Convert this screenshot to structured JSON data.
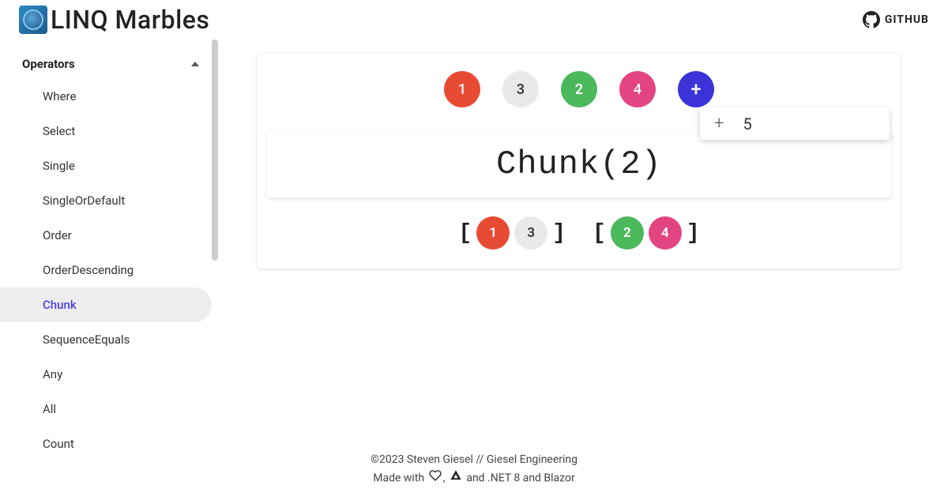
{
  "brand": {
    "title": "LINQ Marbles"
  },
  "header": {
    "github_label": "GITHUB"
  },
  "sidebar": {
    "section_title": "Operators",
    "items": [
      {
        "label": "Where",
        "active": false
      },
      {
        "label": "Select",
        "active": false
      },
      {
        "label": "Single",
        "active": false
      },
      {
        "label": "SingleOrDefault",
        "active": false
      },
      {
        "label": "Order",
        "active": false
      },
      {
        "label": "OrderDescending",
        "active": false
      },
      {
        "label": "Chunk",
        "active": true
      },
      {
        "label": "SequenceEquals",
        "active": false
      },
      {
        "label": "Any",
        "active": false
      },
      {
        "label": "All",
        "active": false
      },
      {
        "label": "Count",
        "active": false
      }
    ]
  },
  "marbles": {
    "input": [
      {
        "value": "1",
        "color": "red"
      },
      {
        "value": "3",
        "color": "gray"
      },
      {
        "value": "2",
        "color": "green"
      },
      {
        "value": "4",
        "color": "pink"
      },
      {
        "value": "+",
        "color": "blue"
      }
    ],
    "tooltip": {
      "icon": "+",
      "value": "5"
    },
    "expression": "Chunk(2)",
    "output_chunks": [
      [
        {
          "value": "1",
          "color": "red"
        },
        {
          "value": "3",
          "color": "gray"
        }
      ],
      [
        {
          "value": "2",
          "color": "green"
        },
        {
          "value": "4",
          "color": "pink"
        }
      ]
    ]
  },
  "footer": {
    "line1": "©2023 Steven Giesel // Giesel Engineering",
    "line2_pre": "Made with",
    "line2_mid": ", ",
    "line2_post": "and .NET 8 and Blazor"
  }
}
